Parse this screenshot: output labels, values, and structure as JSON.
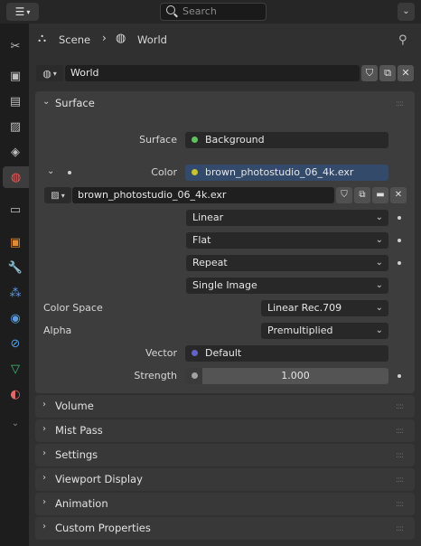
{
  "header": {
    "search_placeholder": "Search",
    "editor_icon": "properties-editor-icon"
  },
  "breadcrumb": {
    "scene": "Scene",
    "world": "World"
  },
  "world_selector": {
    "value": "World"
  },
  "surface_panel": {
    "title": "Surface",
    "surface_label": "Surface",
    "surface_value": "Background",
    "color_label": "Color",
    "color_value": "brown_photostudio_06_4k.exr",
    "image_name": "brown_photostudio_06_4k.exr",
    "interpolation": "Linear",
    "projection": "Flat",
    "extension": "Repeat",
    "source": "Single Image",
    "color_space_label": "Color Space",
    "color_space_value": "Linear Rec.709",
    "alpha_label": "Alpha",
    "alpha_value": "Premultiplied",
    "vector_label": "Vector",
    "vector_value": "Default",
    "strength_label": "Strength",
    "strength_value": "1.000"
  },
  "collapsed_panels": [
    "Volume",
    "Mist Pass",
    "Settings",
    "Viewport Display",
    "Animation",
    "Custom Properties"
  ],
  "colors": {
    "socket_shader": "#5fc25f",
    "socket_color": "#c8c42a",
    "socket_vector": "#6363c7",
    "socket_float": "#a1a1a1",
    "active_tab_accent": "#e05a5a"
  }
}
